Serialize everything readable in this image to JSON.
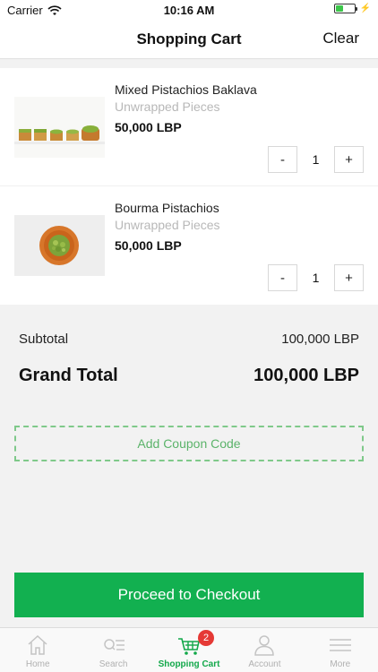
{
  "status_bar": {
    "carrier": "Carrier",
    "time": "10:16 AM"
  },
  "header": {
    "title": "Shopping Cart",
    "clear_label": "Clear"
  },
  "cart": {
    "items": [
      {
        "name": "Mixed Pistachios Baklava",
        "variant": "Unwrapped Pieces",
        "price": "50,000 LBP",
        "quantity": "1",
        "decrement_label": "-",
        "increment_label": "+"
      },
      {
        "name": "Bourma Pistachios",
        "variant": "Unwrapped Pieces",
        "price": "50,000 LBP",
        "quantity": "1",
        "decrement_label": "-",
        "increment_label": "+"
      }
    ]
  },
  "totals": {
    "subtotal_label": "Subtotal",
    "subtotal_value": "100,000 LBP",
    "grand_label": "Grand Total",
    "grand_value": "100,000 LBP"
  },
  "coupon": {
    "label": "Add Coupon Code"
  },
  "checkout": {
    "label": "Proceed to Checkout"
  },
  "tabbar": {
    "tabs": [
      {
        "label": "Home",
        "icon": "home-icon"
      },
      {
        "label": "Search",
        "icon": "search-icon"
      },
      {
        "label": "Shopping Cart",
        "icon": "cart-icon",
        "badge": "2",
        "active": true
      },
      {
        "label": "Account",
        "icon": "account-icon"
      },
      {
        "label": "More",
        "icon": "menu-icon"
      }
    ]
  },
  "colors": {
    "accent_green": "#12b050",
    "coupon_green": "#7fc98a",
    "badge_red": "#e53935",
    "muted_text": "#b8b8b8"
  }
}
